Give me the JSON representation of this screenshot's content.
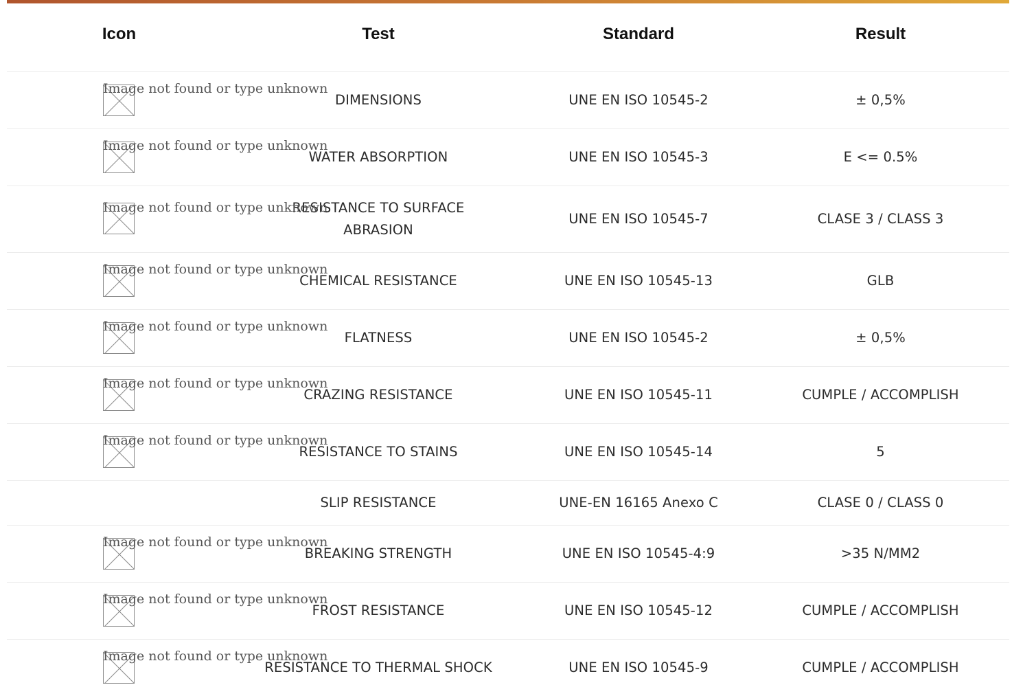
{
  "header": {
    "icon": "Icon",
    "test": "Test",
    "standard": "Standard",
    "result": "Result"
  },
  "broken_image_alt": "Image not found or type unknown",
  "rows": [
    {
      "test": "DIMENSIONS",
      "standard": "UNE EN ISO 10545-2",
      "result": "± 0,5%",
      "has_icon": true
    },
    {
      "test": "WATER ABSORPTION",
      "standard": "UNE EN ISO 10545-3",
      "result": "E <= 0.5%",
      "has_icon": true
    },
    {
      "test": "RESISTANCE TO SURFACE ABRASION",
      "standard": "UNE EN ISO 10545-7",
      "result": "CLASE 3 / CLASS 3",
      "has_icon": true
    },
    {
      "test": "CHEMICAL RESISTANCE",
      "standard": "UNE EN ISO 10545-13",
      "result": "GLB",
      "has_icon": true
    },
    {
      "test": "FLATNESS",
      "standard": "UNE EN ISO 10545-2",
      "result": "± 0,5%",
      "has_icon": true
    },
    {
      "test": "CRAZING RESISTANCE",
      "standard": "UNE EN ISO 10545-11",
      "result": "CUMPLE / ACCOMPLISH",
      "has_icon": true
    },
    {
      "test": "RESISTANCE TO STAINS",
      "standard": "UNE EN ISO 10545-14",
      "result": "5",
      "has_icon": true
    },
    {
      "test": "SLIP RESISTANCE",
      "standard": "UNE-EN 16165 Anexo C",
      "result": "CLASE 0 / CLASS 0",
      "has_icon": false
    },
    {
      "test": "BREAKING STRENGTH",
      "standard": "UNE EN ISO 10545-4:9",
      "result": ">35 N/MM2",
      "has_icon": true
    },
    {
      "test": "FROST RESISTANCE",
      "standard": "UNE EN ISO 10545-12",
      "result": "CUMPLE / ACCOMPLISH",
      "has_icon": true
    },
    {
      "test": "RESISTANCE TO THERMAL SHOCK",
      "standard": "UNE EN ISO 10545-9",
      "result": "CUMPLE / ACCOMPLISH",
      "has_icon": true
    }
  ],
  "colors": {
    "accent_gradient_start": "#b0552d",
    "accent_gradient_end": "#e0a838",
    "row_divider": "#ececec"
  },
  "icons": {
    "broken_image": "broken-image-icon"
  }
}
